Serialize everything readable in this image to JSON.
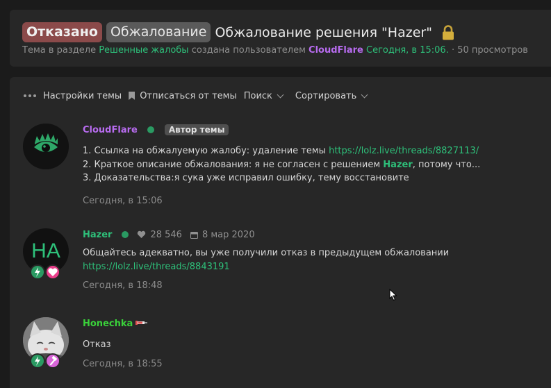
{
  "thread": {
    "prefix_refused": "Отказано",
    "prefix_appeal": "Обжалование",
    "title": "Обжалование решения \"Hazer\"",
    "meta": {
      "part1": "Тема в разделе",
      "section": "Решенные жалобы",
      "part2": "создана пользователем",
      "author": "CloudFlare",
      "created": "Сегодня, в 15:06.",
      "views": "· 50 просмотров"
    }
  },
  "toolbar": {
    "settings": "Настройки темы",
    "unsubscribe": "Отписаться от темы",
    "search": "Поиск",
    "sort": "Сортировать"
  },
  "posts": [
    {
      "author": "CloudFlare",
      "author_color": "#b86cf0",
      "badge": "Автор темы",
      "lines": {
        "l1_text": "1. Ссылка на обжалуемую жалобу: удаление темы ",
        "l1_link": "https://lolz.live/threads/8827113/",
        "l2_text": "2. Краткое описание обжалования: я не согласен с решением ",
        "l2_mention": "Hazer",
        "l2_tail": ", потому что...",
        "l3_text": "3. Доказательства:я сука уже исправил ошибку, тему восстановите"
      },
      "date": "Сегодня, в 15:06"
    },
    {
      "author": "Hazer",
      "author_color": "#2ec07a",
      "likes": "28 546",
      "registered": "8 мар 2020",
      "avatar_text": "HA",
      "lines": {
        "l1_text": "Общайтесь адекватно, вы уже получили отказ в предыдущем обжаловании",
        "l2_link": "https://lolz.live/threads/8843191"
      },
      "date": "Сегодня, в 18:48"
    },
    {
      "author": "Honechka",
      "author_color": "#3ad13a",
      "lines": {
        "l1_text": "Отказ"
      },
      "date": "Сегодня, в 18:55"
    }
  ]
}
